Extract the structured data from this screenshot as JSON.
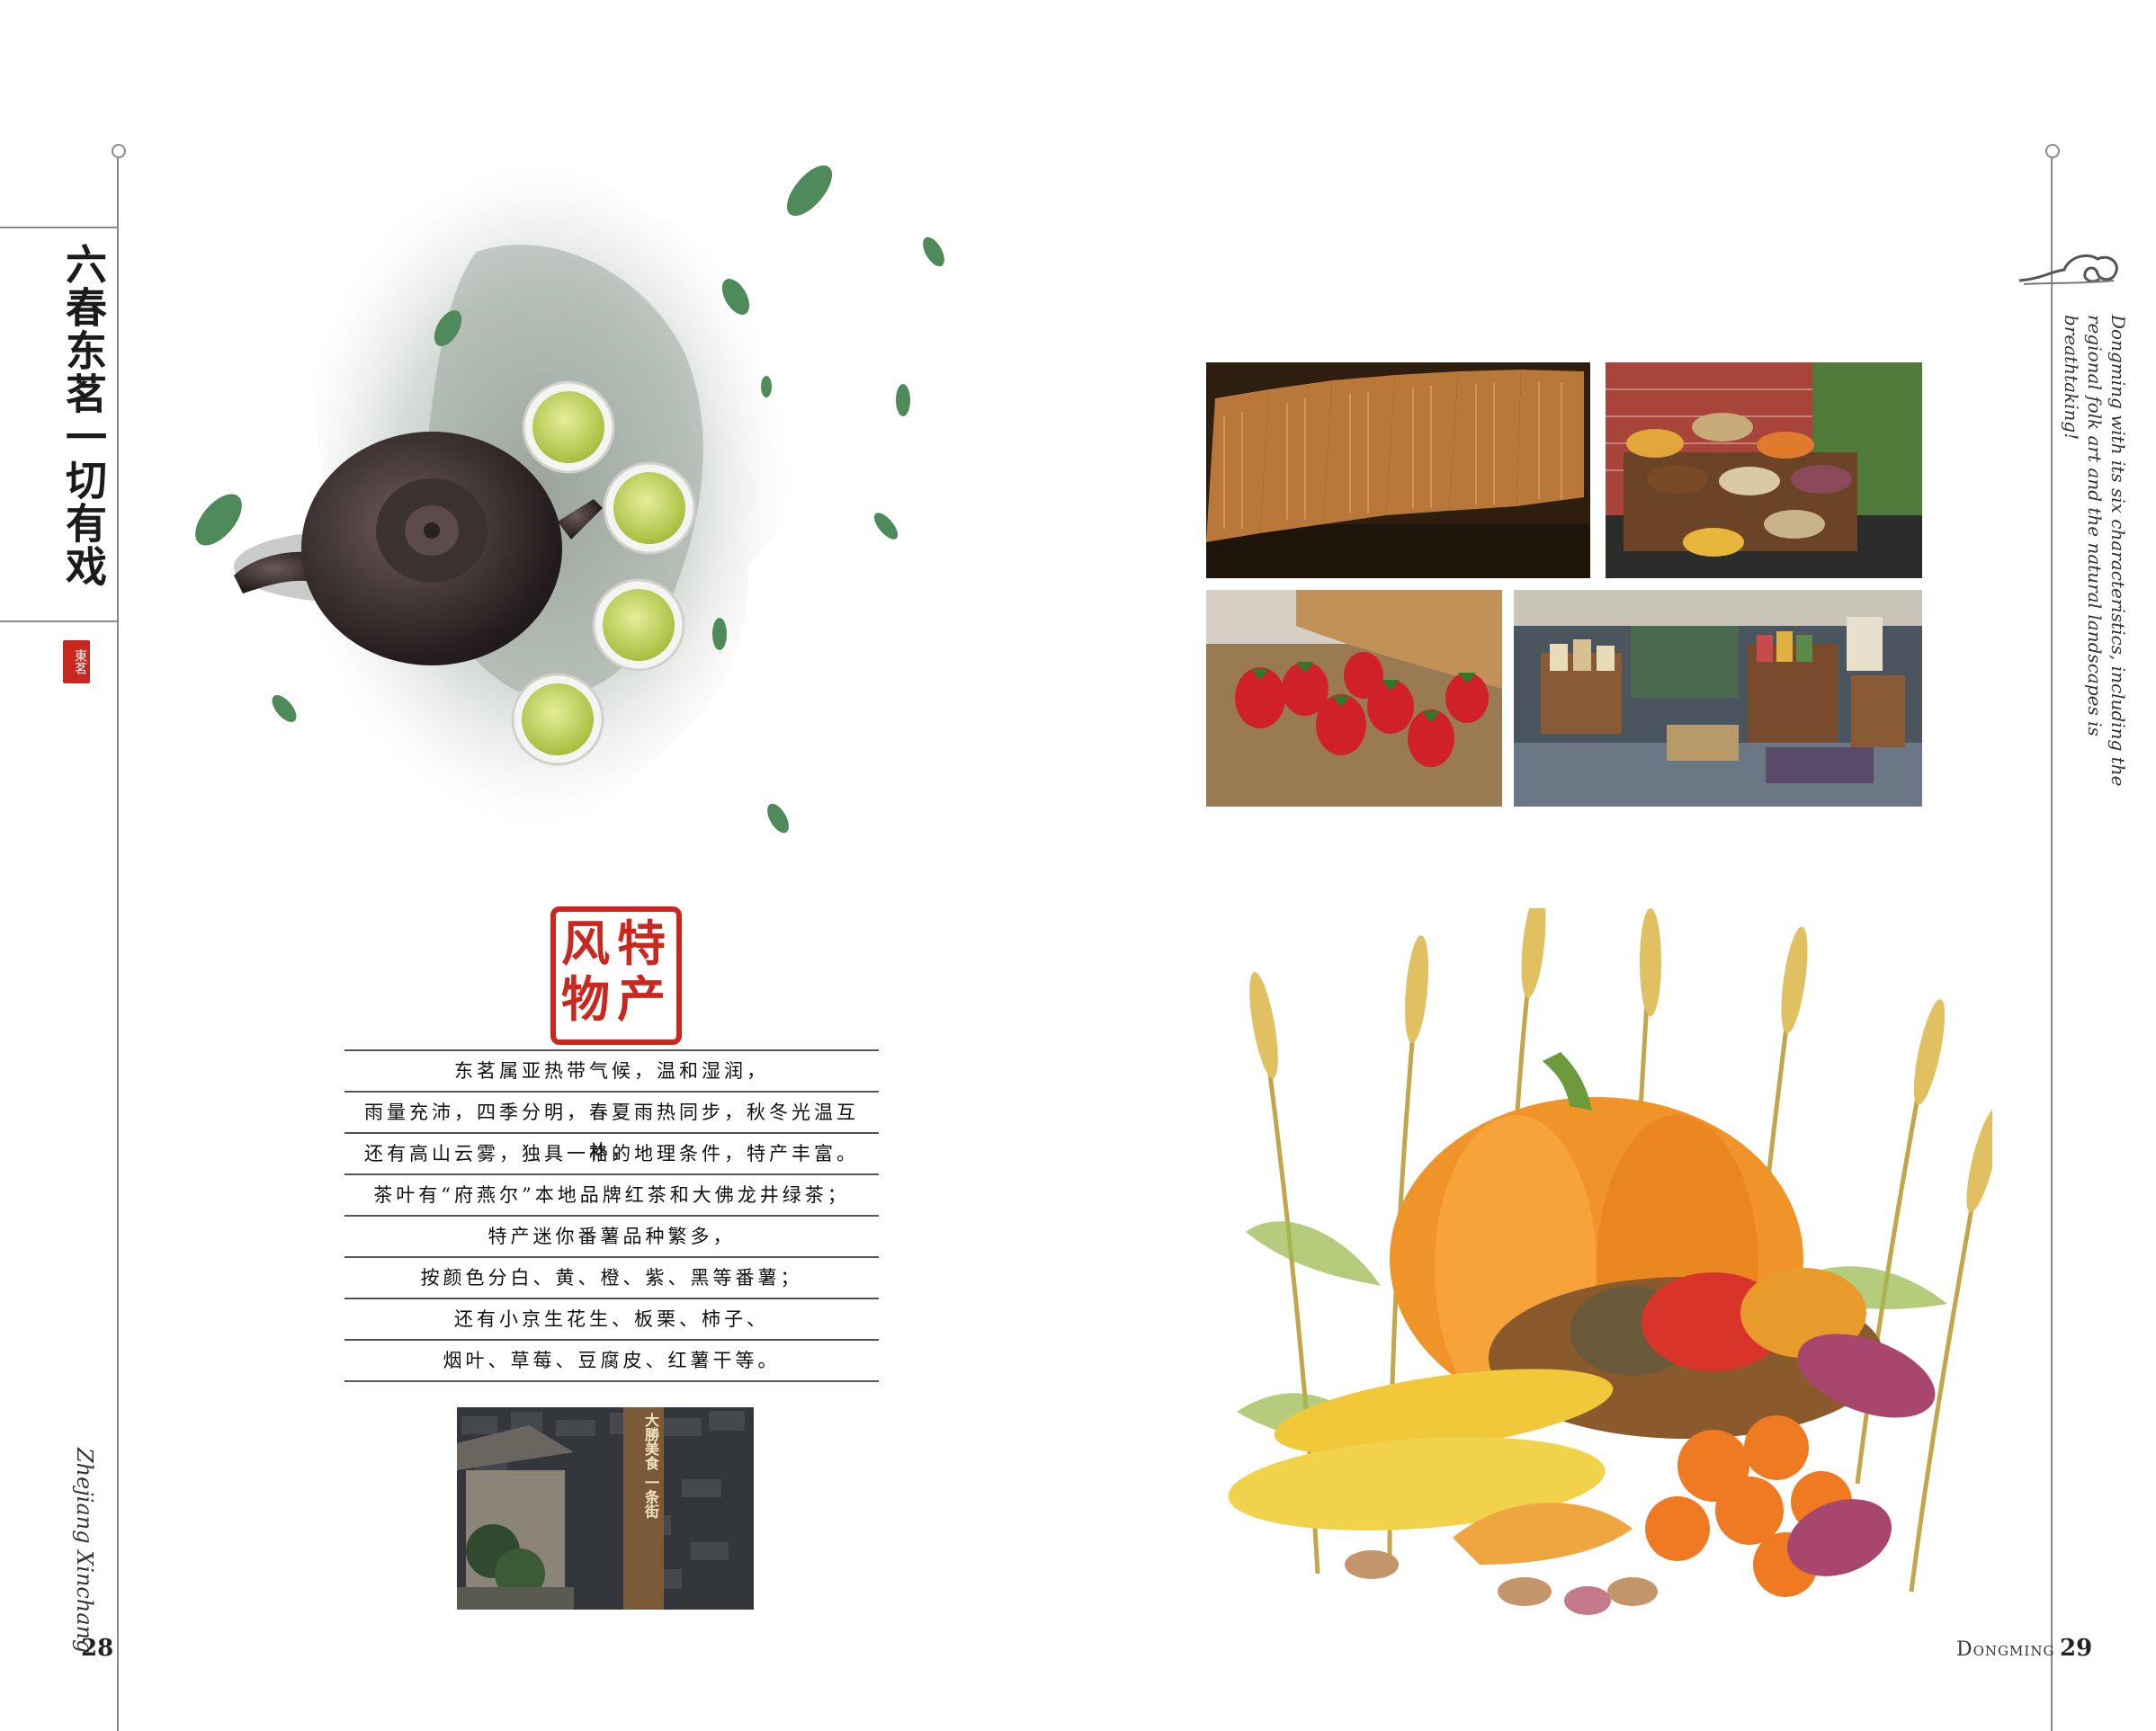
{
  "left_page": {
    "vertical_title": "六春东茗一切有戏",
    "small_seal": "東茗",
    "seal_chars": [
      "特",
      "产",
      "风",
      "物"
    ],
    "body_lines": [
      "东茗属亚热带气候，温和湿润，",
      "雨量充沛，四季分明，春夏雨热同步，秋冬光温互补，",
      "还有高山云雾，独具一格的地理条件，特产丰富。",
      "茶叶有“府燕尔”本地品牌红茶和大佛龙井绿茶；",
      "特产迷你番薯品种繁多，",
      "按颜色分白、黄、橙、紫、黑等番薯；",
      "还有小京生花生、板栗、柿子、",
      "烟叶、草莓、豆腐皮、红薯干等。"
    ],
    "photo_sign": "大勝美食 一条街",
    "footer_en": "Zhejiang Xinchang",
    "page_number": "28"
  },
  "right_page": {
    "side_caption": "Dongming with its six characteristics, including the regional folk art and the natural landscapes is breathtaking!",
    "footer_label": "Dongming",
    "page_number": "29"
  },
  "colors": {
    "seal_red": "#c8281f",
    "rule_gray": "#8a8a8a",
    "tea_green": "#c9d86a"
  }
}
